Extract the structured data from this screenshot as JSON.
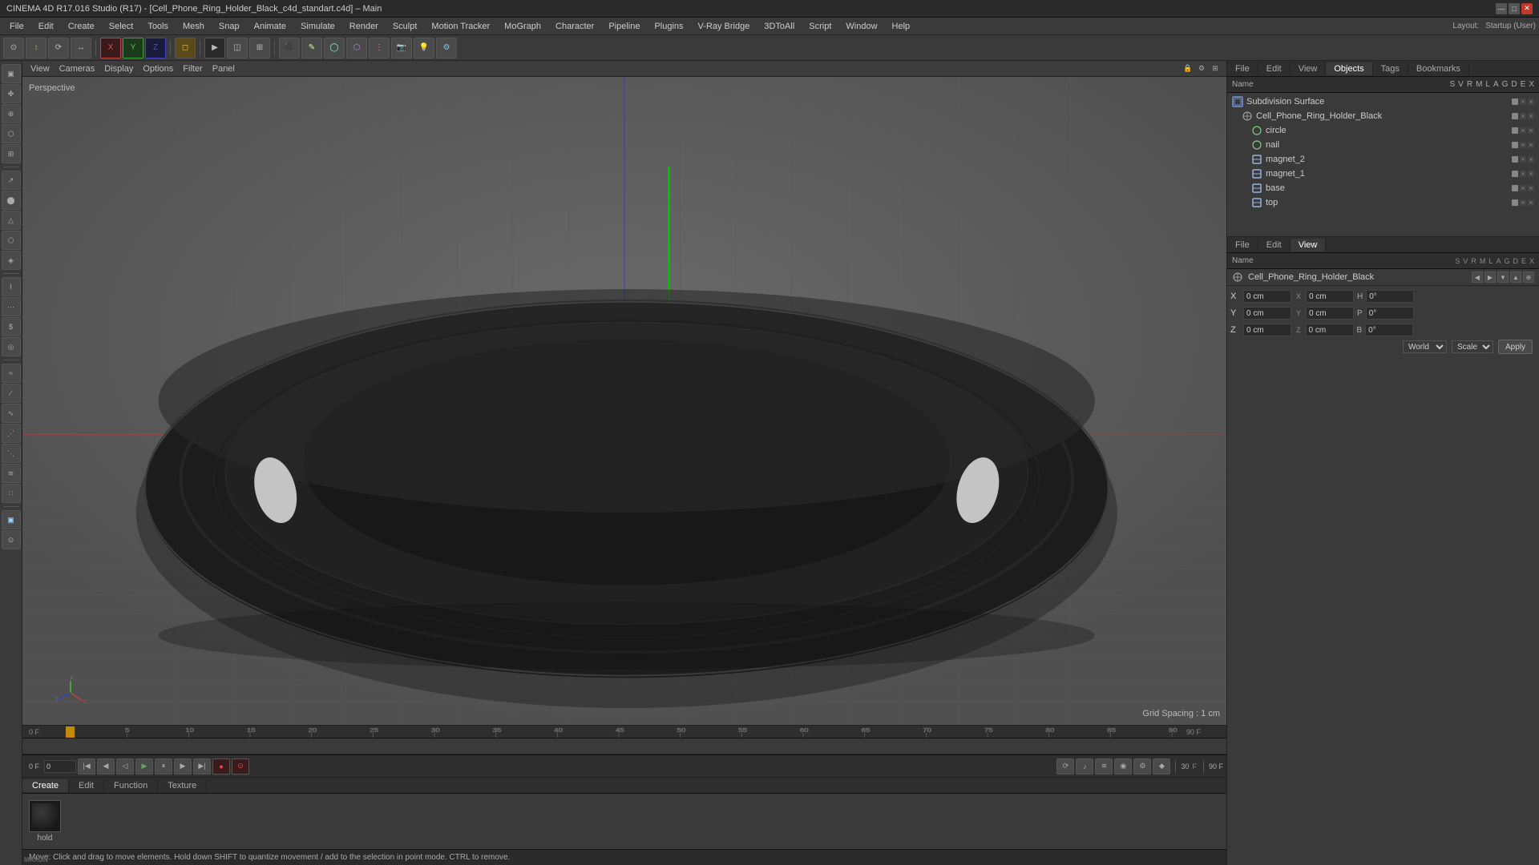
{
  "titlebar": {
    "title": "CINEMA 4D R17.016 Studio (R17) - [Cell_Phone_Ring_Holder_Black_c4d_standart.c4d] – Main"
  },
  "menubar": {
    "items": [
      "File",
      "Edit",
      "Create",
      "Select",
      "Tools",
      "Mesh",
      "Snap",
      "Animate",
      "Simulate",
      "Render",
      "Sculpt",
      "Motion Tracker",
      "MoGraph",
      "Character",
      "Pipeline",
      "Plugins",
      "V-Ray Bridge",
      "3DToAll",
      "Script",
      "Window",
      "Help"
    ]
  },
  "toolbar": {
    "groups": [
      "move",
      "rotate",
      "scale",
      "render",
      "objects"
    ]
  },
  "viewport": {
    "label": "Perspective",
    "grid_spacing": "Grid Spacing : 1 cm",
    "menus": [
      "View",
      "Cameras",
      "Display",
      "Options",
      "Filter",
      "Panel"
    ]
  },
  "timeline": {
    "current_frame": "0 F",
    "end_frame": "90 F",
    "fps": "30",
    "markers": [
      0,
      5,
      10,
      15,
      20,
      25,
      30,
      35,
      40,
      45,
      50,
      55,
      60,
      65,
      70,
      75,
      80,
      85,
      90
    ]
  },
  "playback": {
    "current_frame_display": "0 F",
    "fps_display": "30",
    "end_frame_display": "90 F"
  },
  "objects_panel": {
    "tabs": [
      "File",
      "Edit",
      "View",
      "Objects",
      "Tags",
      "Bookmarks"
    ],
    "columns": [
      "Name",
      "S",
      "V",
      "R",
      "M",
      "L",
      "A",
      "G",
      "D",
      "E",
      "X"
    ],
    "items": [
      {
        "name": "Subdivision Surface",
        "level": 0,
        "icon": "cube",
        "active": true
      },
      {
        "name": "Cell_Phone_Ring_Holder_Black",
        "level": 1,
        "icon": "null"
      },
      {
        "name": "circle",
        "level": 2,
        "icon": "spline"
      },
      {
        "name": "nail",
        "level": 2,
        "icon": "spline"
      },
      {
        "name": "magnet_2",
        "level": 2,
        "icon": "poly"
      },
      {
        "name": "magnet_1",
        "level": 2,
        "icon": "poly"
      },
      {
        "name": "base",
        "level": 2,
        "icon": "poly"
      },
      {
        "name": "top",
        "level": 2,
        "icon": "poly"
      }
    ]
  },
  "properties_panel": {
    "tabs": [
      "File",
      "Edit",
      "View"
    ],
    "columns": [
      "Name",
      "S",
      "V",
      "R",
      "M",
      "L",
      "A",
      "G",
      "D",
      "E",
      "X"
    ],
    "object_name": "Cell_Phone_Ring_Holder_Black"
  },
  "coordinates": {
    "x_label": "X",
    "y_label": "Y",
    "z_label": "Z",
    "x_pos": "0 cm",
    "y_pos": "0 cm",
    "z_pos": "0 cm",
    "x_size": "0 cm",
    "y_size": "0 cm",
    "z_size": "0 cm",
    "h_label": "H",
    "p_label": "P",
    "b_label": "B",
    "h_val": "0°",
    "p_val": "0°",
    "b_val": "0°",
    "coord_system": "World",
    "scale_label": "Scale",
    "apply_label": "Apply"
  },
  "material_panel": {
    "tabs": [
      "Create",
      "Edit",
      "Function",
      "Texture"
    ],
    "materials": [
      {
        "name": "hold",
        "color": "#1a1a1a"
      }
    ]
  },
  "status_bar": {
    "text": "Move: Click and drag to move elements. Hold down SHIFT to quantize movement / add to the selection in point mode. CTRL to remove."
  },
  "layout": {
    "name": "Startup (User)"
  }
}
